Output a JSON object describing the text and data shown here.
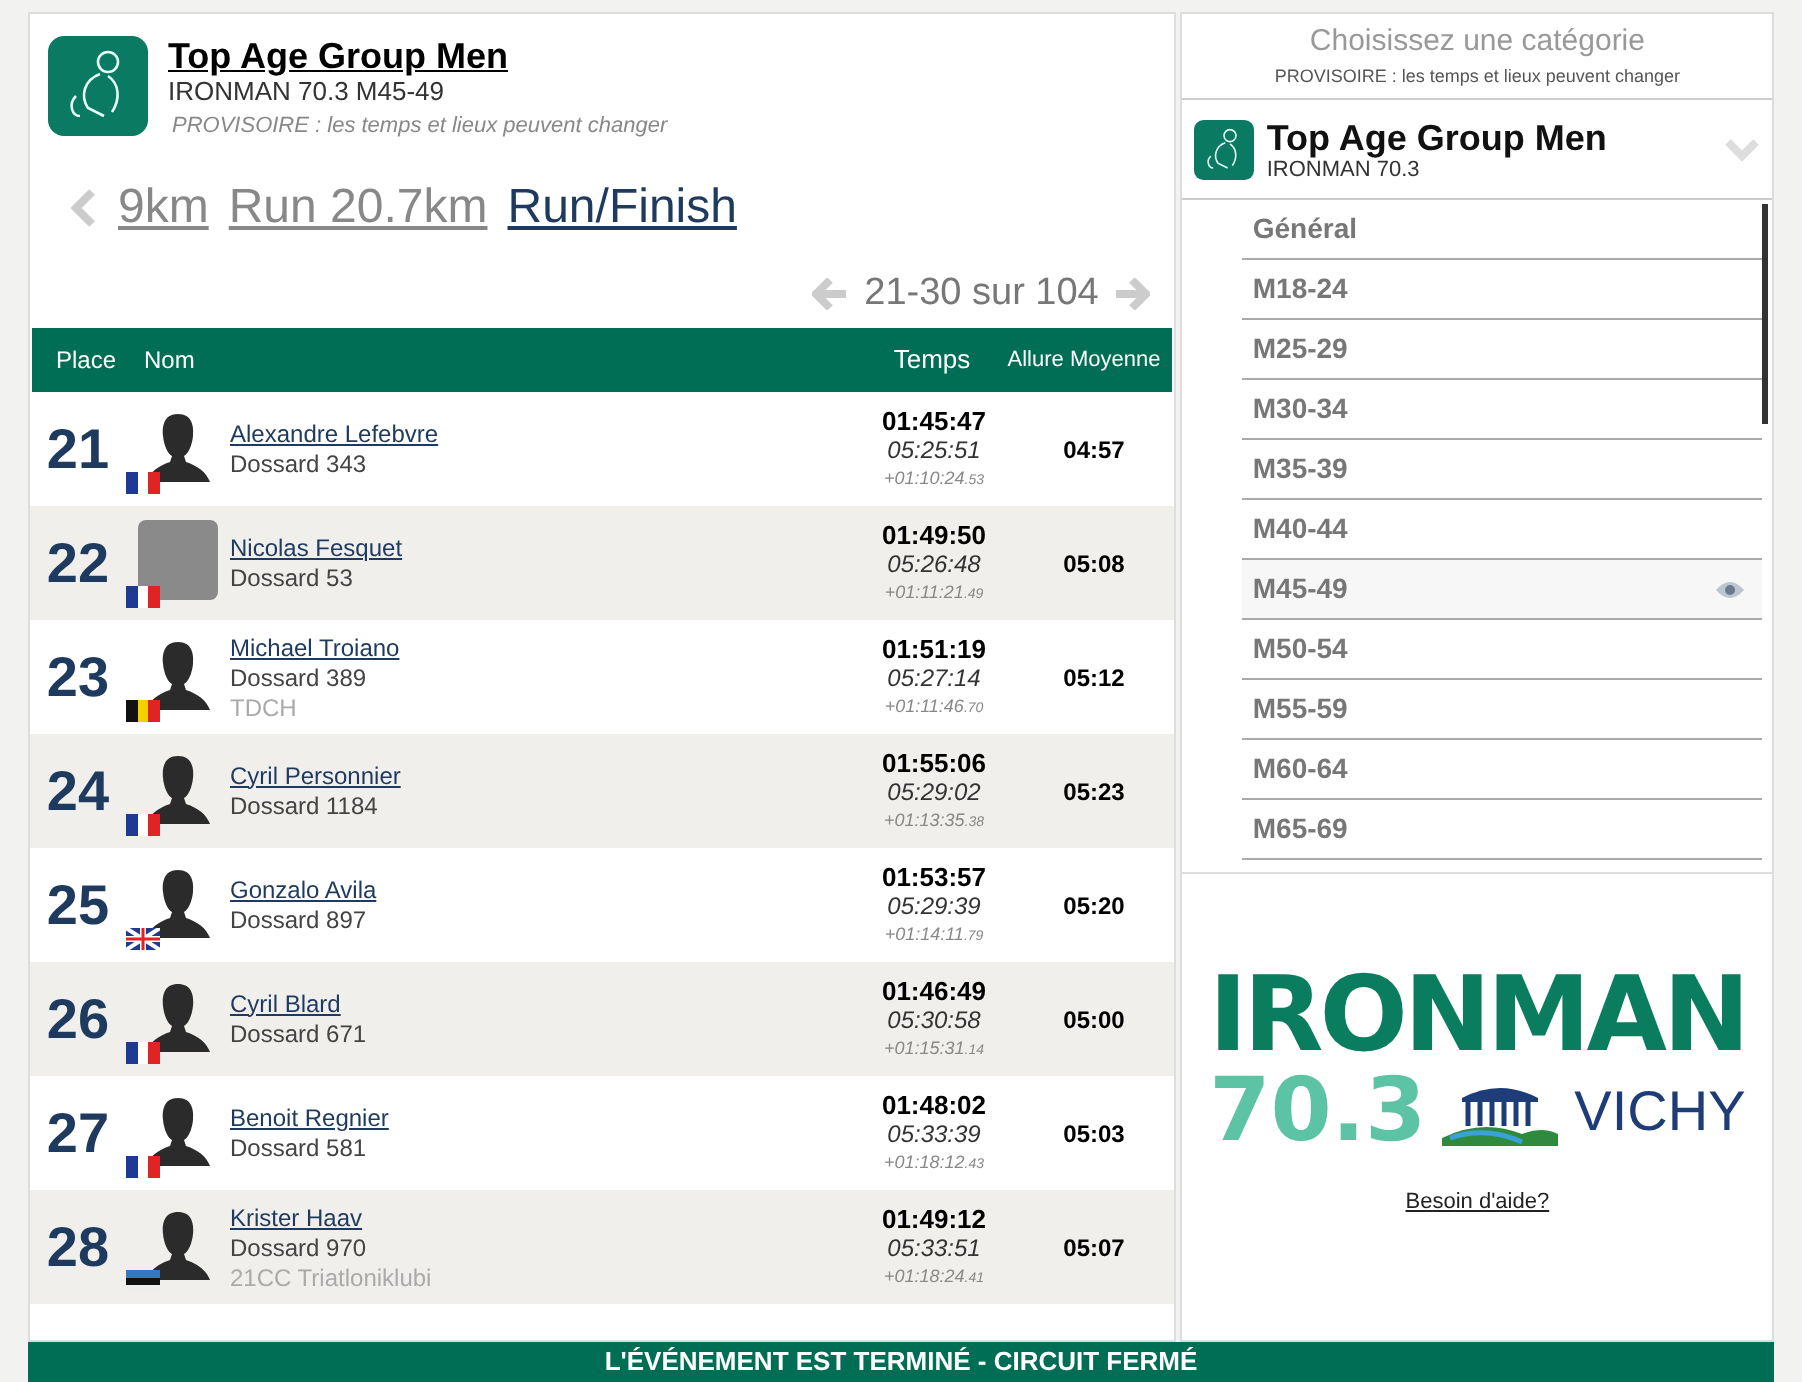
{
  "header": {
    "title": "Top Age Group Men",
    "subtitle": "IRONMAN 70.3 M45-49",
    "notice": "PROVISOIRE : les temps et lieux peuvent changer"
  },
  "splits": [
    {
      "label": "9km",
      "selected": false
    },
    {
      "label": "Run 20.7km",
      "selected": false
    },
    {
      "label": "Run/Finish",
      "selected": true
    }
  ],
  "pagination": {
    "label": "21-30 sur 104"
  },
  "table": {
    "columns": [
      "Place",
      "Nom",
      "Temps",
      "Allure Moyenne"
    ],
    "rows": [
      {
        "place": "21",
        "name": "Alexandre Lefebvre",
        "bib": "Dossard 343",
        "flag": {
          "kind": "france"
        },
        "photo": false,
        "split_time": "01:45:47",
        "total_time": "05:25:51",
        "gap": "+01:10:24",
        "gap_fraction": ".53",
        "pace": "04:57"
      },
      {
        "place": "22",
        "name": "Nicolas Fesquet",
        "bib": "Dossard 53",
        "flag": {
          "kind": "france"
        },
        "photo": true,
        "split_time": "01:49:50",
        "total_time": "05:26:48",
        "gap": "+01:11:21",
        "gap_fraction": ".49",
        "pace": "05:08"
      },
      {
        "place": "23",
        "name": "Michael Troiano",
        "bib": "Dossard 389",
        "club": "TDCH",
        "flag": {
          "kind": "belgium"
        },
        "photo": false,
        "split_time": "01:51:19",
        "total_time": "05:27:14",
        "gap": "+01:11:46",
        "gap_fraction": ".70",
        "pace": "05:12"
      },
      {
        "place": "24",
        "name": "Cyril Personnier",
        "bib": "Dossard 1184",
        "flag": {
          "kind": "france"
        },
        "photo": false,
        "split_time": "01:55:06",
        "total_time": "05:29:02",
        "gap": "+01:13:35",
        "gap_fraction": ".38",
        "pace": "05:23"
      },
      {
        "place": "25",
        "name": "Gonzalo Avila",
        "bib": "Dossard 897",
        "flag": {
          "kind": "uk"
        },
        "photo": false,
        "split_time": "01:53:57",
        "total_time": "05:29:39",
        "gap": "+01:14:11",
        "gap_fraction": ".79",
        "pace": "05:20"
      },
      {
        "place": "26",
        "name": "Cyril Blard",
        "bib": "Dossard 671",
        "flag": {
          "kind": "france"
        },
        "photo": false,
        "split_time": "01:46:49",
        "total_time": "05:30:58",
        "gap": "+01:15:31",
        "gap_fraction": ".14",
        "pace": "05:00"
      },
      {
        "place": "27",
        "name": "Benoit Regnier",
        "bib": "Dossard 581",
        "flag": {
          "kind": "france"
        },
        "photo": false,
        "split_time": "01:48:02",
        "total_time": "05:33:39",
        "gap": "+01:18:12",
        "gap_fraction": ".43",
        "pace": "05:03"
      },
      {
        "place": "28",
        "name": "Krister Haav",
        "bib": "Dossard 970",
        "club": "21CC Triatloniklubi",
        "flag": {
          "kind": "estonia"
        },
        "photo": false,
        "split_time": "01:49:12",
        "total_time": "05:33:51",
        "gap": "+01:18:24",
        "gap_fraction": ".41",
        "pace": "05:07"
      }
    ]
  },
  "sidebar": {
    "heading": "Choisissez une catégorie",
    "notice": "PROVISOIRE : les temps et lieux peuvent changer",
    "selector": {
      "title": "Top Age Group Men",
      "subtitle": "IRONMAN 70.3"
    },
    "categories": [
      {
        "label": "Général",
        "selected": false
      },
      {
        "label": "M18-24",
        "selected": false
      },
      {
        "label": "M25-29",
        "selected": false
      },
      {
        "label": "M30-34",
        "selected": false
      },
      {
        "label": "M35-39",
        "selected": false
      },
      {
        "label": "M40-44",
        "selected": false
      },
      {
        "label": "M45-49",
        "selected": true
      },
      {
        "label": "M50-54",
        "selected": false
      },
      {
        "label": "M55-59",
        "selected": false
      },
      {
        "label": "M60-64",
        "selected": false
      },
      {
        "label": "M65-69",
        "selected": false
      }
    ],
    "logo": {
      "brand": "IRONMAN",
      "distance": "70.3",
      "city": "VICHY"
    },
    "help_link": "Besoin d'aide?"
  },
  "status_bar": {
    "text": "L'ÉVÉNEMENT EST TERMINÉ - CIRCUIT FERMÉ"
  }
}
